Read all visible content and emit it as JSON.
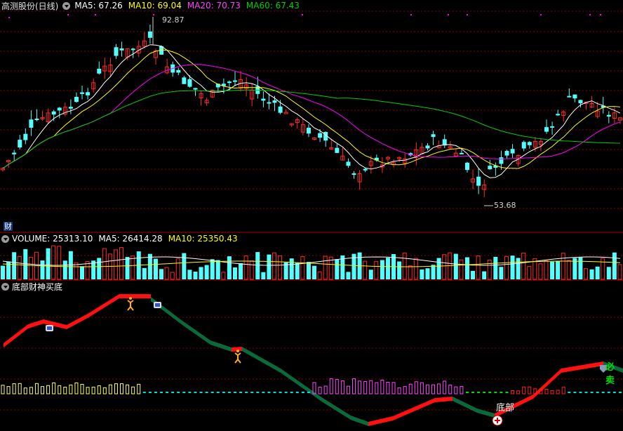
{
  "main_header": {
    "title": "高测股份(日线)",
    "ma5": "MA5: 67.26",
    "ma10": "MA10: 69.04",
    "ma20": "MA20: 70.73",
    "ma60": "MA60: 67.43"
  },
  "annotations": {
    "high": "92.87",
    "low": "53.68",
    "cai_badge": "财"
  },
  "volume_header": {
    "volume": "VOLUME: 25313.10",
    "ma5": "MA5: 26414.28",
    "ma10": "MA10: 25350.43"
  },
  "indicator_header": {
    "title": "底部财神买底"
  },
  "indicator_labels": {
    "bottom": "底部",
    "sell": "必卖"
  },
  "colors": {
    "up": "#ff2a2a",
    "down": "#54ffff",
    "ma5": "#ffffff",
    "ma10": "#ffff00",
    "ma20": "#ff00ff",
    "ma60": "#00d000",
    "grid": "#8b0000"
  },
  "icons": [
    "teacup-icon",
    "running-man-icon",
    "plus-circle-icon",
    "shield-icon"
  ]
}
